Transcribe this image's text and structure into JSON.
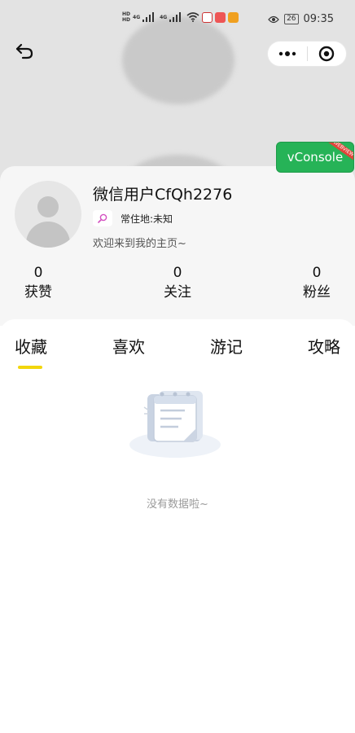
{
  "status_bar": {
    "time": "09:35",
    "battery": "26",
    "network_1": "4G",
    "network_2": "4G",
    "hd_1": "HD",
    "hd_2": "HD"
  },
  "nav": {
    "back_icon": "back-arrow-icon",
    "more_icon": "more-dots-icon",
    "close_icon": "target-close-icon"
  },
  "vconsole": {
    "label": "vConsole",
    "tag": "WEBVIEW",
    "color": "#26b357"
  },
  "profile": {
    "username": "微信用户CfQh2276",
    "location_label": "常住地:",
    "location_value": "未知",
    "intro": "欢迎来到我的主页~",
    "stats": [
      {
        "value": "0",
        "label": "获赞"
      },
      {
        "value": "0",
        "label": "关注"
      },
      {
        "value": "0",
        "label": "粉丝"
      }
    ]
  },
  "tabs": [
    {
      "label": "收藏",
      "active": true
    },
    {
      "label": "喜欢",
      "active": false
    },
    {
      "label": "游记",
      "active": false
    },
    {
      "label": "攻略",
      "active": false
    }
  ],
  "accent_color": "#f2d60d",
  "empty_state": {
    "icon": "empty-notebook-icon",
    "text": "没有数据啦~"
  }
}
